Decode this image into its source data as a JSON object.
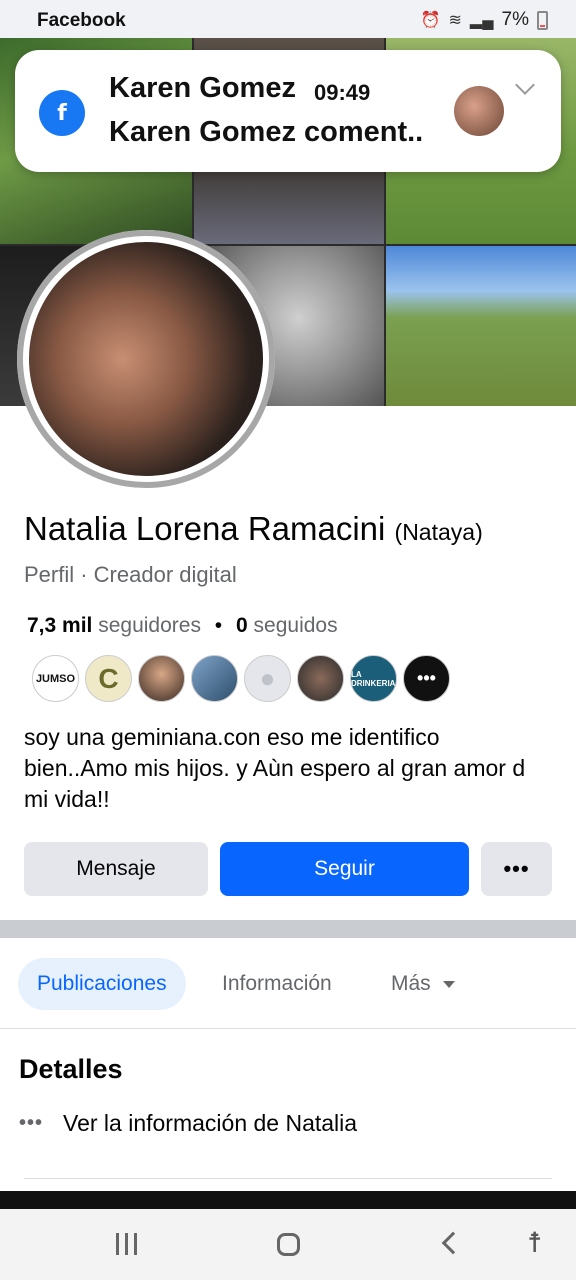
{
  "status_bar": {
    "app_label": "Facebook",
    "battery": "7%",
    "icons": [
      "alarm-icon",
      "wifi-icon",
      "volte-icon",
      "signal-icon",
      "battery-icon"
    ]
  },
  "notification": {
    "sender": "Karen Gomez",
    "time": "09:49",
    "body": "Karen Gomez coment..",
    "app_icon": "facebook-icon"
  },
  "profile": {
    "name": "Natalia Lorena Ramacini",
    "nickname": "(Nataya)",
    "subtitle": "Perfil · Creador digital",
    "followers_count": "7,3 mil",
    "followers_label": "seguidores",
    "following_count": "0",
    "following_label": "seguidos",
    "bio": "soy una geminiana.con eso me identifico bien..Amo mis hijos. y Aùn espero al gran amor d mi vida!!"
  },
  "friend_avatars": [
    {
      "label": "JUMSO"
    },
    {
      "label": "C"
    },
    {
      "label": ""
    },
    {
      "label": ""
    },
    {
      "label": ""
    },
    {
      "label": ""
    },
    {
      "label": "LA DRINKERIA"
    },
    {
      "label": "•••"
    }
  ],
  "actions": {
    "message": "Mensaje",
    "follow": "Seguir",
    "more": "•••"
  },
  "tabs": {
    "posts": "Publicaciones",
    "info": "Información",
    "more": "Más"
  },
  "details": {
    "title": "Detalles",
    "dots": "•••",
    "link": "Ver la información de Natalia"
  },
  "colors": {
    "brand_blue": "#0866ff",
    "facebook_blue": "#1877f2",
    "secondary_text": "#65676b",
    "button_gray": "#e4e6eb"
  }
}
